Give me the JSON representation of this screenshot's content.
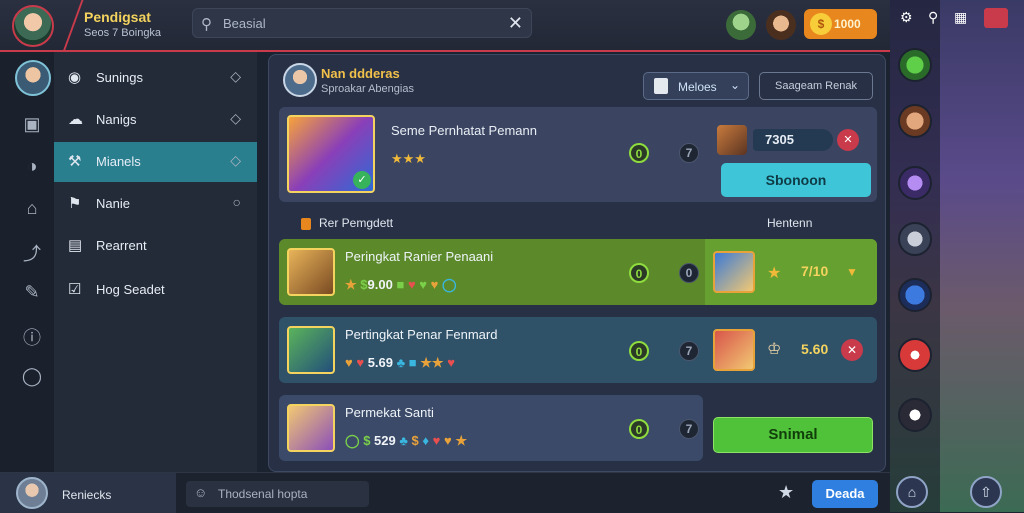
{
  "header": {
    "title": "Pendigsat",
    "subtitle": "Seos 7 Boingka",
    "search_placeholder": "Beasial",
    "coins": "1000"
  },
  "sidebar": {
    "items": [
      {
        "label": "Sunings",
        "icon": "gamepad-icon",
        "active": false
      },
      {
        "label": "Nanigs",
        "icon": "cloud-icon",
        "active": false
      },
      {
        "label": "Mianels",
        "icon": "tool-icon",
        "active": true
      },
      {
        "label": "Nanie",
        "icon": "flag-icon",
        "active": false
      },
      {
        "label": "Rearrent",
        "icon": "list-icon",
        "active": false
      },
      {
        "label": "Hog Seadet",
        "icon": "checkbox-icon",
        "active": false
      }
    ]
  },
  "bottom": {
    "profile_name": "Reniecks",
    "input_placeholder": "Thodsenal hopta",
    "button_label": "Deada"
  },
  "panel": {
    "title": "Nan ddderas",
    "subtitle": "Sproakar Abengias",
    "dropdown_label": "Meloes",
    "outline_button": "Saageam Renak",
    "featured": {
      "title": "Seme Pernhatat Pemann",
      "stars": "★★★",
      "badge_1": "0",
      "badge_2": "7",
      "amount": "7305",
      "cta_label": "Sbonoon"
    },
    "section_label": "Rer Pemgdett",
    "section_right": "Hentenn",
    "rows": [
      {
        "title": "Peringkat Ranier Penaani",
        "stat_value": "9.00",
        "badge_1": "0",
        "badge_2": "0",
        "right_value": "7/10",
        "bg": "#5c8a2a",
        "right_bg": "#66a030"
      },
      {
        "title": "Pertingkat Penar Fenmard",
        "stat_value": "5.69",
        "badge_1": "0",
        "badge_2": "7",
        "right_value": "5.60",
        "bg": "#2f5269",
        "right_bg": "#2f5269"
      },
      {
        "title": "Permekat Santi",
        "stat_value": "529",
        "badge_1": "0",
        "badge_2": "7",
        "right_value": "",
        "bg": "#3a4a68",
        "right_bg": "transparent"
      }
    ],
    "green_button": "Snimal"
  }
}
